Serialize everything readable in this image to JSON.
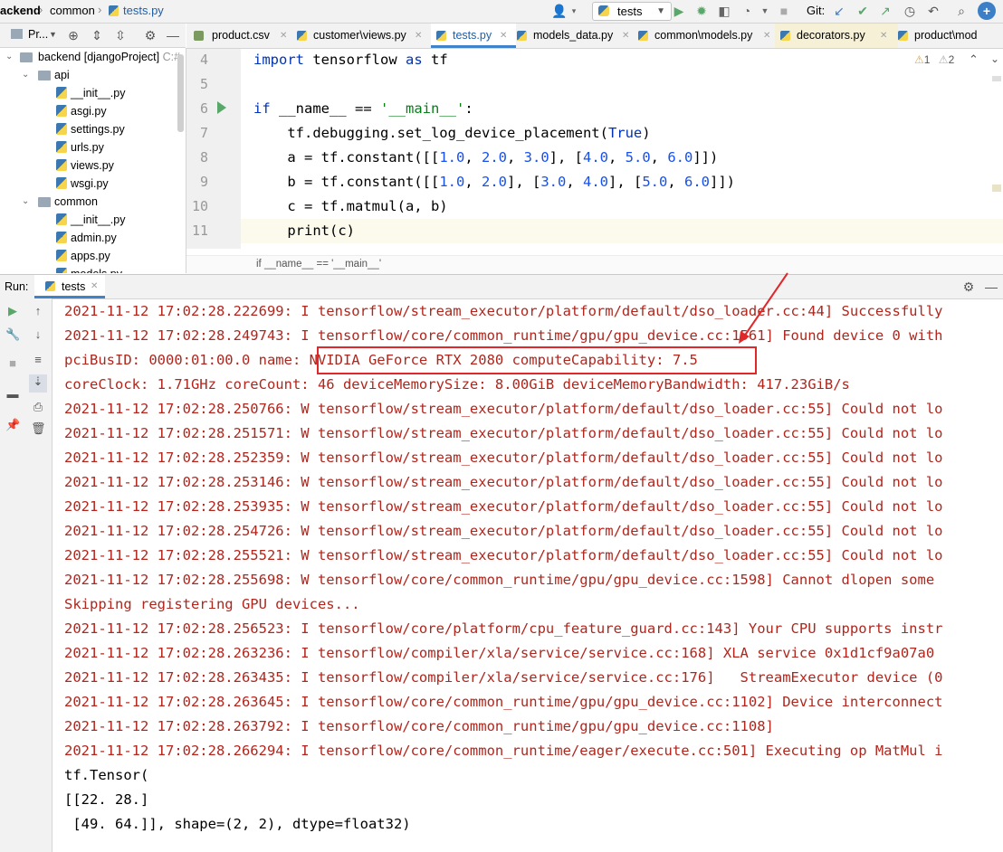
{
  "nav": {
    "breadcrumb": [
      "ackend",
      "common",
      "tests.py"
    ],
    "run_config": "tests",
    "git_label": "Git:"
  },
  "project": {
    "panel_label": "Pr...",
    "tree": [
      {
        "label": "backend [djangoProject]",
        "hint": "C:#",
        "kind": "folder",
        "expanded": true
      },
      {
        "label": "api",
        "kind": "folder",
        "expanded": true
      },
      {
        "label": "__init__.py",
        "kind": "file"
      },
      {
        "label": "asgi.py",
        "kind": "file"
      },
      {
        "label": "settings.py",
        "kind": "file"
      },
      {
        "label": "urls.py",
        "kind": "file"
      },
      {
        "label": "views.py",
        "kind": "file"
      },
      {
        "label": "wsgi.py",
        "kind": "file"
      },
      {
        "label": "common",
        "kind": "folder",
        "expanded": true
      },
      {
        "label": "__init__.py",
        "kind": "file"
      },
      {
        "label": "admin.py",
        "kind": "file"
      },
      {
        "label": "apps.py",
        "kind": "file"
      },
      {
        "label": "models.py",
        "kind": "file"
      }
    ]
  },
  "editor": {
    "tabs": [
      "product.csv",
      "customer\\views.py",
      "tests.py",
      "models_data.py",
      "common\\models.py",
      "decorators.py",
      "product\\mod"
    ],
    "warnings": "1",
    "weak_warnings": "2",
    "line_numbers": [
      "4",
      "5",
      "6",
      "7",
      "8",
      "9",
      "10",
      "11"
    ],
    "lines": [
      "import tensorflow as tf",
      "",
      "if __name__ == '__main__':",
      "    tf.debugging.set_log_device_placement(True)",
      "    a = tf.constant([[1.0, 2.0, 3.0], [4.0, 5.0, 6.0]])",
      "    b = tf.constant([[1.0, 2.0], [3.0, 4.0], [5.0, 6.0]])",
      "    c = tf.matmul(a, b)",
      "    print(c)"
    ],
    "breadcrumb": "if __name__ == '__main__'"
  },
  "run": {
    "label": "Run:",
    "tab": "tests",
    "output": [
      "2021-11-12 17:02:28.222699: I tensorflow/stream_executor/platform/default/dso_loader.cc:44] Successfully",
      "2021-11-12 17:02:28.249743: I tensorflow/core/common_runtime/gpu/gpu_device.cc:1561] Found device 0 with",
      "pciBusID: 0000:01:00.0 name: NVIDIA GeForce RTX 2080 computeCapability: 7.5",
      "coreClock: 1.71GHz coreCount: 46 deviceMemorySize: 8.00GiB deviceMemoryBandwidth: 417.23GiB/s",
      "2021-11-12 17:02:28.250766: W tensorflow/stream_executor/platform/default/dso_loader.cc:55] Could not lo",
      "2021-11-12 17:02:28.251571: W tensorflow/stream_executor/platform/default/dso_loader.cc:55] Could not lo",
      "2021-11-12 17:02:28.252359: W tensorflow/stream_executor/platform/default/dso_loader.cc:55] Could not lo",
      "2021-11-12 17:02:28.253146: W tensorflow/stream_executor/platform/default/dso_loader.cc:55] Could not lo",
      "2021-11-12 17:02:28.253935: W tensorflow/stream_executor/platform/default/dso_loader.cc:55] Could not lo",
      "2021-11-12 17:02:28.254726: W tensorflow/stream_executor/platform/default/dso_loader.cc:55] Could not lo",
      "2021-11-12 17:02:28.255521: W tensorflow/stream_executor/platform/default/dso_loader.cc:55] Could not lo",
      "2021-11-12 17:02:28.255698: W tensorflow/core/common_runtime/gpu/gpu_device.cc:1598] Cannot dlopen some",
      "Skipping registering GPU devices...",
      "2021-11-12 17:02:28.256523: I tensorflow/core/platform/cpu_feature_guard.cc:143] Your CPU supports instr",
      "2021-11-12 17:02:28.263236: I tensorflow/compiler/xla/service/service.cc:168] XLA service 0x1d1cf9a07a0",
      "2021-11-12 17:02:28.263435: I tensorflow/compiler/xla/service/service.cc:176]   StreamExecutor device (0",
      "2021-11-12 17:02:28.263645: I tensorflow/core/common_runtime/gpu/gpu_device.cc:1102] Device interconnect",
      "2021-11-12 17:02:28.263792: I tensorflow/core/common_runtime/gpu/gpu_device.cc:1108]",
      "2021-11-12 17:02:28.266294: I tensorflow/core/common_runtime/eager/execute.cc:501] Executing op MatMul i",
      "tf.Tensor(",
      "[[22. 28.]",
      " [49. 64.]], shape=(2, 2), dtype=float32)"
    ],
    "plain_from": 19
  },
  "colors": {
    "stderr": "#b0261d",
    "highlight": "#e0282b",
    "accent": "#4083c9"
  }
}
